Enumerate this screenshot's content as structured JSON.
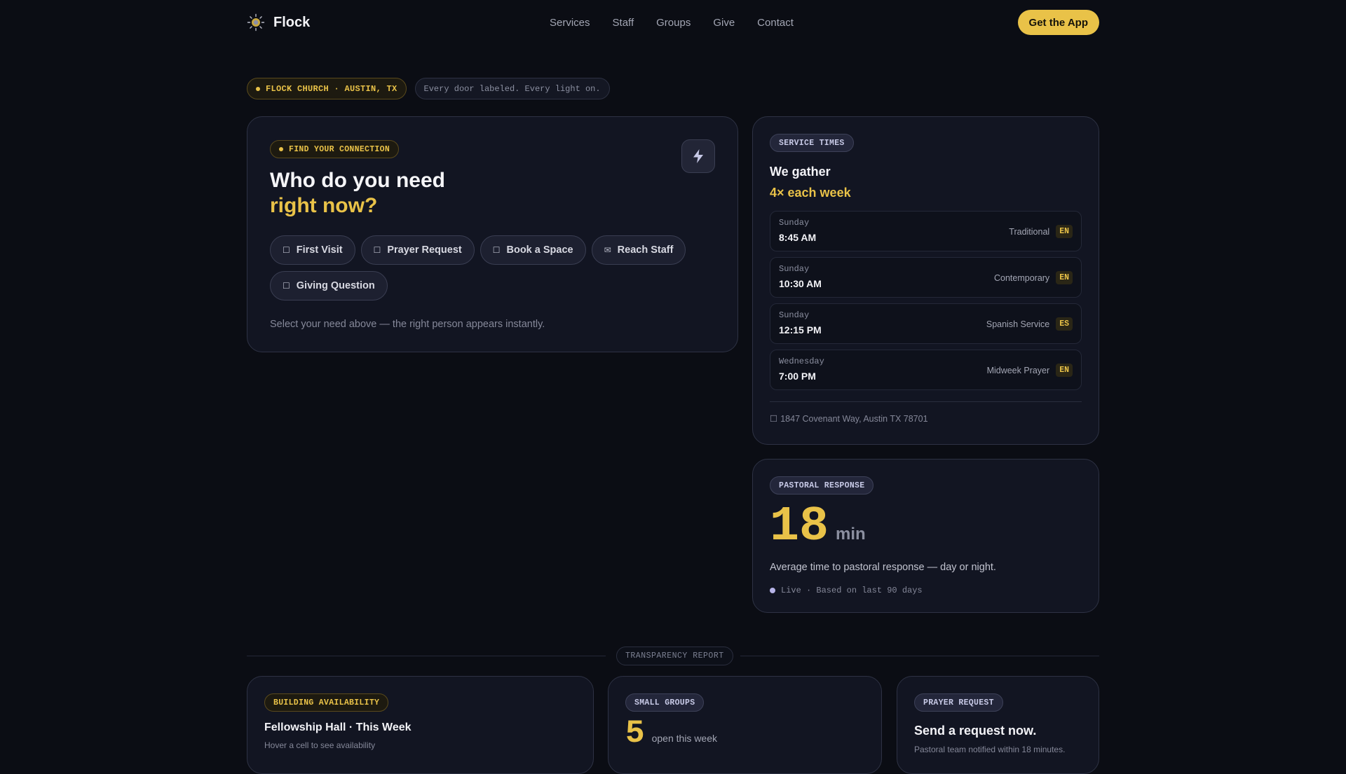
{
  "nav": {
    "brand": "Flock",
    "links": [
      "Services",
      "Staff",
      "Groups",
      "Give",
      "Contact"
    ],
    "cta": "Get the App"
  },
  "tags": {
    "location": "FLOCK CHURCH · AUSTIN, TX",
    "motto": "Every door labeled. Every light on."
  },
  "hero": {
    "badge": "FIND YOUR CONNECTION",
    "title_line1": "Who do you need",
    "title_line2": "right now?",
    "chips": [
      {
        "icon": "☐",
        "label": "First Visit"
      },
      {
        "icon": "☐",
        "label": "Prayer Request"
      },
      {
        "icon": "☐",
        "label": "Book a Space"
      },
      {
        "icon": "✉",
        "label": "Reach Staff"
      },
      {
        "icon": "☐",
        "label": "Giving Question"
      }
    ],
    "hint": "Select your need above — the right person appears instantly."
  },
  "services": {
    "badge": "SERVICE TIMES",
    "title": "We gather",
    "subtitle": "4× each week",
    "items": [
      {
        "day": "Sunday",
        "time": "8:45 AM",
        "type": "Traditional",
        "lang": "EN"
      },
      {
        "day": "Sunday",
        "time": "10:30 AM",
        "type": "Contemporary",
        "lang": "EN"
      },
      {
        "day": "Sunday",
        "time": "12:15 PM",
        "type": "Spanish Service",
        "lang": "ES"
      },
      {
        "day": "Wednesday",
        "time": "7:00 PM",
        "type": "Midweek Prayer",
        "lang": "EN"
      }
    ],
    "address_icon": "☐",
    "address": "1847 Covenant Way, Austin TX 78701"
  },
  "pastoral": {
    "badge": "PASTORAL RESPONSE",
    "value": "18",
    "unit": "min",
    "description": "Average time to pastoral response — day or night.",
    "live": "Live · Based on last 90 days"
  },
  "transparency": {
    "label": "TRANSPARENCY REPORT",
    "building": {
      "badge": "BUILDING AVAILABILITY",
      "title": "Fellowship Hall · This Week",
      "sub": "Hover a cell to see availability"
    },
    "groups": {
      "badge": "SMALL GROUPS",
      "value": "5",
      "unit": "open this week"
    },
    "prayer": {
      "badge": "PRAYER REQUEST",
      "title": "Send a request now.",
      "sub": "Pastoral team notified within 18 minutes."
    }
  },
  "colors": {
    "background": "#0b0d14",
    "accent": "#e9c248",
    "card": "#121522",
    "lavender": "#b7b4e8"
  }
}
